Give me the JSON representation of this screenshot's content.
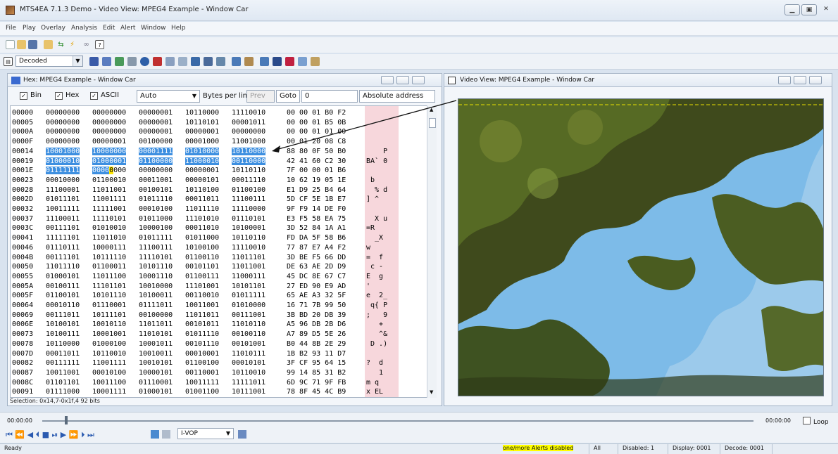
{
  "window": {
    "title": "MTS4EA 7.1.3 Demo - Video View: MPEG4 Example - Window Car"
  },
  "menu": [
    "File",
    "Play",
    "Overlay",
    "Analysis",
    "Edit",
    "Alert",
    "Window",
    "Help"
  ],
  "toolbar": {
    "decoded_value": "Decoded"
  },
  "hex_panel": {
    "title": "Hex: MPEG4 Example - Window Car",
    "options": {
      "bin_label": "Bin",
      "hex_label": "Hex",
      "ascii_label": "ASCII",
      "bin_checked": true,
      "hex_checked": true,
      "ascii_checked": true
    },
    "auto_value": "Auto",
    "bytes_per_line_label": "Bytes per line",
    "prev_label": "Prev",
    "goto_label": "Goto",
    "goto_value": "0",
    "address_mode": "Absolute address",
    "selection": "Selection: 0x14,7-0x1f,4 92 bits",
    "rows": [
      {
        "a": "00000",
        "b": [
          "00000000",
          "00000000",
          "00000001",
          "10110000",
          "11110010"
        ],
        "h": "00 00 01 B0 F2",
        "s": ""
      },
      {
        "a": "00005",
        "b": [
          "00000000",
          "00000000",
          "00000001",
          "10110101",
          "00001011"
        ],
        "h": "00 00 01 B5 0B",
        "s": ""
      },
      {
        "a": "0000A",
        "b": [
          "00000000",
          "00000000",
          "00000001",
          "00000001",
          "00000000"
        ],
        "h": "00 00 01 01 00",
        "s": ""
      },
      {
        "a": "0000F",
        "b": [
          "00000000",
          "00000001",
          "00100000",
          "00001000",
          "11001000"
        ],
        "h": "00 01 20 08 C8",
        "s": ""
      },
      {
        "a": "00014",
        "b": [
          "10001000",
          "10000000",
          "00001111",
          "01010000",
          "10110000"
        ],
        "h": "88 80 0F 50 B0",
        "s": "    P"
      },
      {
        "a": "00019",
        "b": [
          "01000010",
          "01000001",
          "01100000",
          "11000010",
          "00110000"
        ],
        "h": "42 41 60 C2 30",
        "s": "BA` 0"
      },
      {
        "a": "0001E",
        "b": [
          "01111111",
          "00000000",
          "00000000",
          "00000001",
          "10110110"
        ],
        "h": "7F 00 00 01 B6",
        "s": ""
      },
      {
        "a": "00023",
        "b": [
          "00010000",
          "01100010",
          "00011001",
          "00000101",
          "00011110"
        ],
        "h": "10 62 19 05 1E",
        "s": " b"
      },
      {
        "a": "00028",
        "b": [
          "11100001",
          "11011001",
          "00100101",
          "10110100",
          "01100100"
        ],
        "h": "E1 D9 25 B4 64",
        "s": "  % d"
      },
      {
        "a": "0002D",
        "b": [
          "01011101",
          "11001111",
          "01011110",
          "00011011",
          "11100111"
        ],
        "h": "5D CF 5E 1B E7",
        "s": "] ^"
      },
      {
        "a": "00032",
        "b": [
          "10011111",
          "11111001",
          "00010100",
          "11011110",
          "11110000"
        ],
        "h": "9F F9 14 DE F0",
        "s": ""
      },
      {
        "a": "00037",
        "b": [
          "11100011",
          "11110101",
          "01011000",
          "11101010",
          "01110101"
        ],
        "h": "E3 F5 58 EA 75",
        "s": "  X u"
      },
      {
        "a": "0003C",
        "b": [
          "00111101",
          "01010010",
          "10000100",
          "00011010",
          "10100001"
        ],
        "h": "3D 52 84 1A A1",
        "s": "=R"
      },
      {
        "a": "00041",
        "b": [
          "11111101",
          "11011010",
          "01011111",
          "01011000",
          "10110110"
        ],
        "h": "FD DA 5F 58 B6",
        "s": "  _X"
      },
      {
        "a": "00046",
        "b": [
          "01110111",
          "10000111",
          "11100111",
          "10100100",
          "11110010"
        ],
        "h": "77 87 E7 A4 F2",
        "s": "w"
      },
      {
        "a": "0004B",
        "b": [
          "00111101",
          "10111110",
          "11110101",
          "01100110",
          "11011101"
        ],
        "h": "3D BE F5 66 DD",
        "s": "=  f"
      },
      {
        "a": "00050",
        "b": [
          "11011110",
          "01100011",
          "10101110",
          "00101101",
          "11011001"
        ],
        "h": "DE 63 AE 2D D9",
        "s": " c -"
      },
      {
        "a": "00055",
        "b": [
          "01000101",
          "11011100",
          "10001110",
          "01100111",
          "11000111"
        ],
        "h": "45 DC 8E 67 C7",
        "s": "E  g"
      },
      {
        "a": "0005A",
        "b": [
          "00100111",
          "11101101",
          "10010000",
          "11101001",
          "10101101"
        ],
        "h": "27 ED 90 E9 AD",
        "s": "'"
      },
      {
        "a": "0005F",
        "b": [
          "01100101",
          "10101110",
          "10100011",
          "00110010",
          "01011111"
        ],
        "h": "65 AE A3 32 5F",
        "s": "e  2_"
      },
      {
        "a": "00064",
        "b": [
          "00010110",
          "01110001",
          "01111011",
          "10011001",
          "01010000"
        ],
        "h": "16 71 7B 99 50",
        "s": " q{ P"
      },
      {
        "a": "00069",
        "b": [
          "00111011",
          "10111101",
          "00100000",
          "11011011",
          "00111001"
        ],
        "h": "3B BD 20 DB 39",
        "s": ";   9"
      },
      {
        "a": "0006E",
        "b": [
          "10100101",
          "10010110",
          "11011011",
          "00101011",
          "11010110"
        ],
        "h": "A5 96 DB 2B D6",
        "s": "   +"
      },
      {
        "a": "00073",
        "b": [
          "10100111",
          "10001001",
          "11010101",
          "01011110",
          "00100110"
        ],
        "h": "A7 89 D5 5E 26",
        "s": "   ^&"
      },
      {
        "a": "00078",
        "b": [
          "10110000",
          "01000100",
          "10001011",
          "00101110",
          "00101001"
        ],
        "h": "B0 44 8B 2E 29",
        "s": " D .)"
      },
      {
        "a": "0007D",
        "b": [
          "00011011",
          "10110010",
          "10010011",
          "00010001",
          "11010111"
        ],
        "h": "1B B2 93 11 D7",
        "s": ""
      },
      {
        "a": "00082",
        "b": [
          "00111111",
          "11001111",
          "10010101",
          "01100100",
          "00010101"
        ],
        "h": "3F CF 95 64 15",
        "s": "?  d"
      },
      {
        "a": "00087",
        "b": [
          "10011001",
          "00010100",
          "10000101",
          "00110001",
          "10110010"
        ],
        "h": "99 14 85 31 B2",
        "s": "   1"
      },
      {
        "a": "0008C",
        "b": [
          "01101101",
          "10011100",
          "01110001",
          "10011111",
          "11111011"
        ],
        "h": "6D 9C 71 9F FB",
        "s": "m q"
      },
      {
        "a": "00091",
        "b": [
          "01111000",
          "10001111",
          "01000101",
          "01001100",
          "10111001"
        ],
        "h": "78 8F 45 4C B9",
        "s": "x EL"
      }
    ]
  },
  "video_panel": {
    "title": "Video View: MPEG4 Example - Window Car"
  },
  "transport": {
    "time_left": "00:00:00",
    "time_right": "00:00:00",
    "loop_label": "Loop",
    "vop_value": "I-VOP"
  },
  "status": {
    "ready": "Ready",
    "alerts": "one/more Alerts disabled",
    "all": "All",
    "disabled": "Disabled: 1",
    "display": "Display: 0001",
    "decode": "Decode: 0001"
  },
  "colors": {
    "accent": "#3d8fe0",
    "alert_bg": "#ffff00",
    "ascii_bg": "#f7d7dc",
    "cursor": "#ffe600"
  }
}
